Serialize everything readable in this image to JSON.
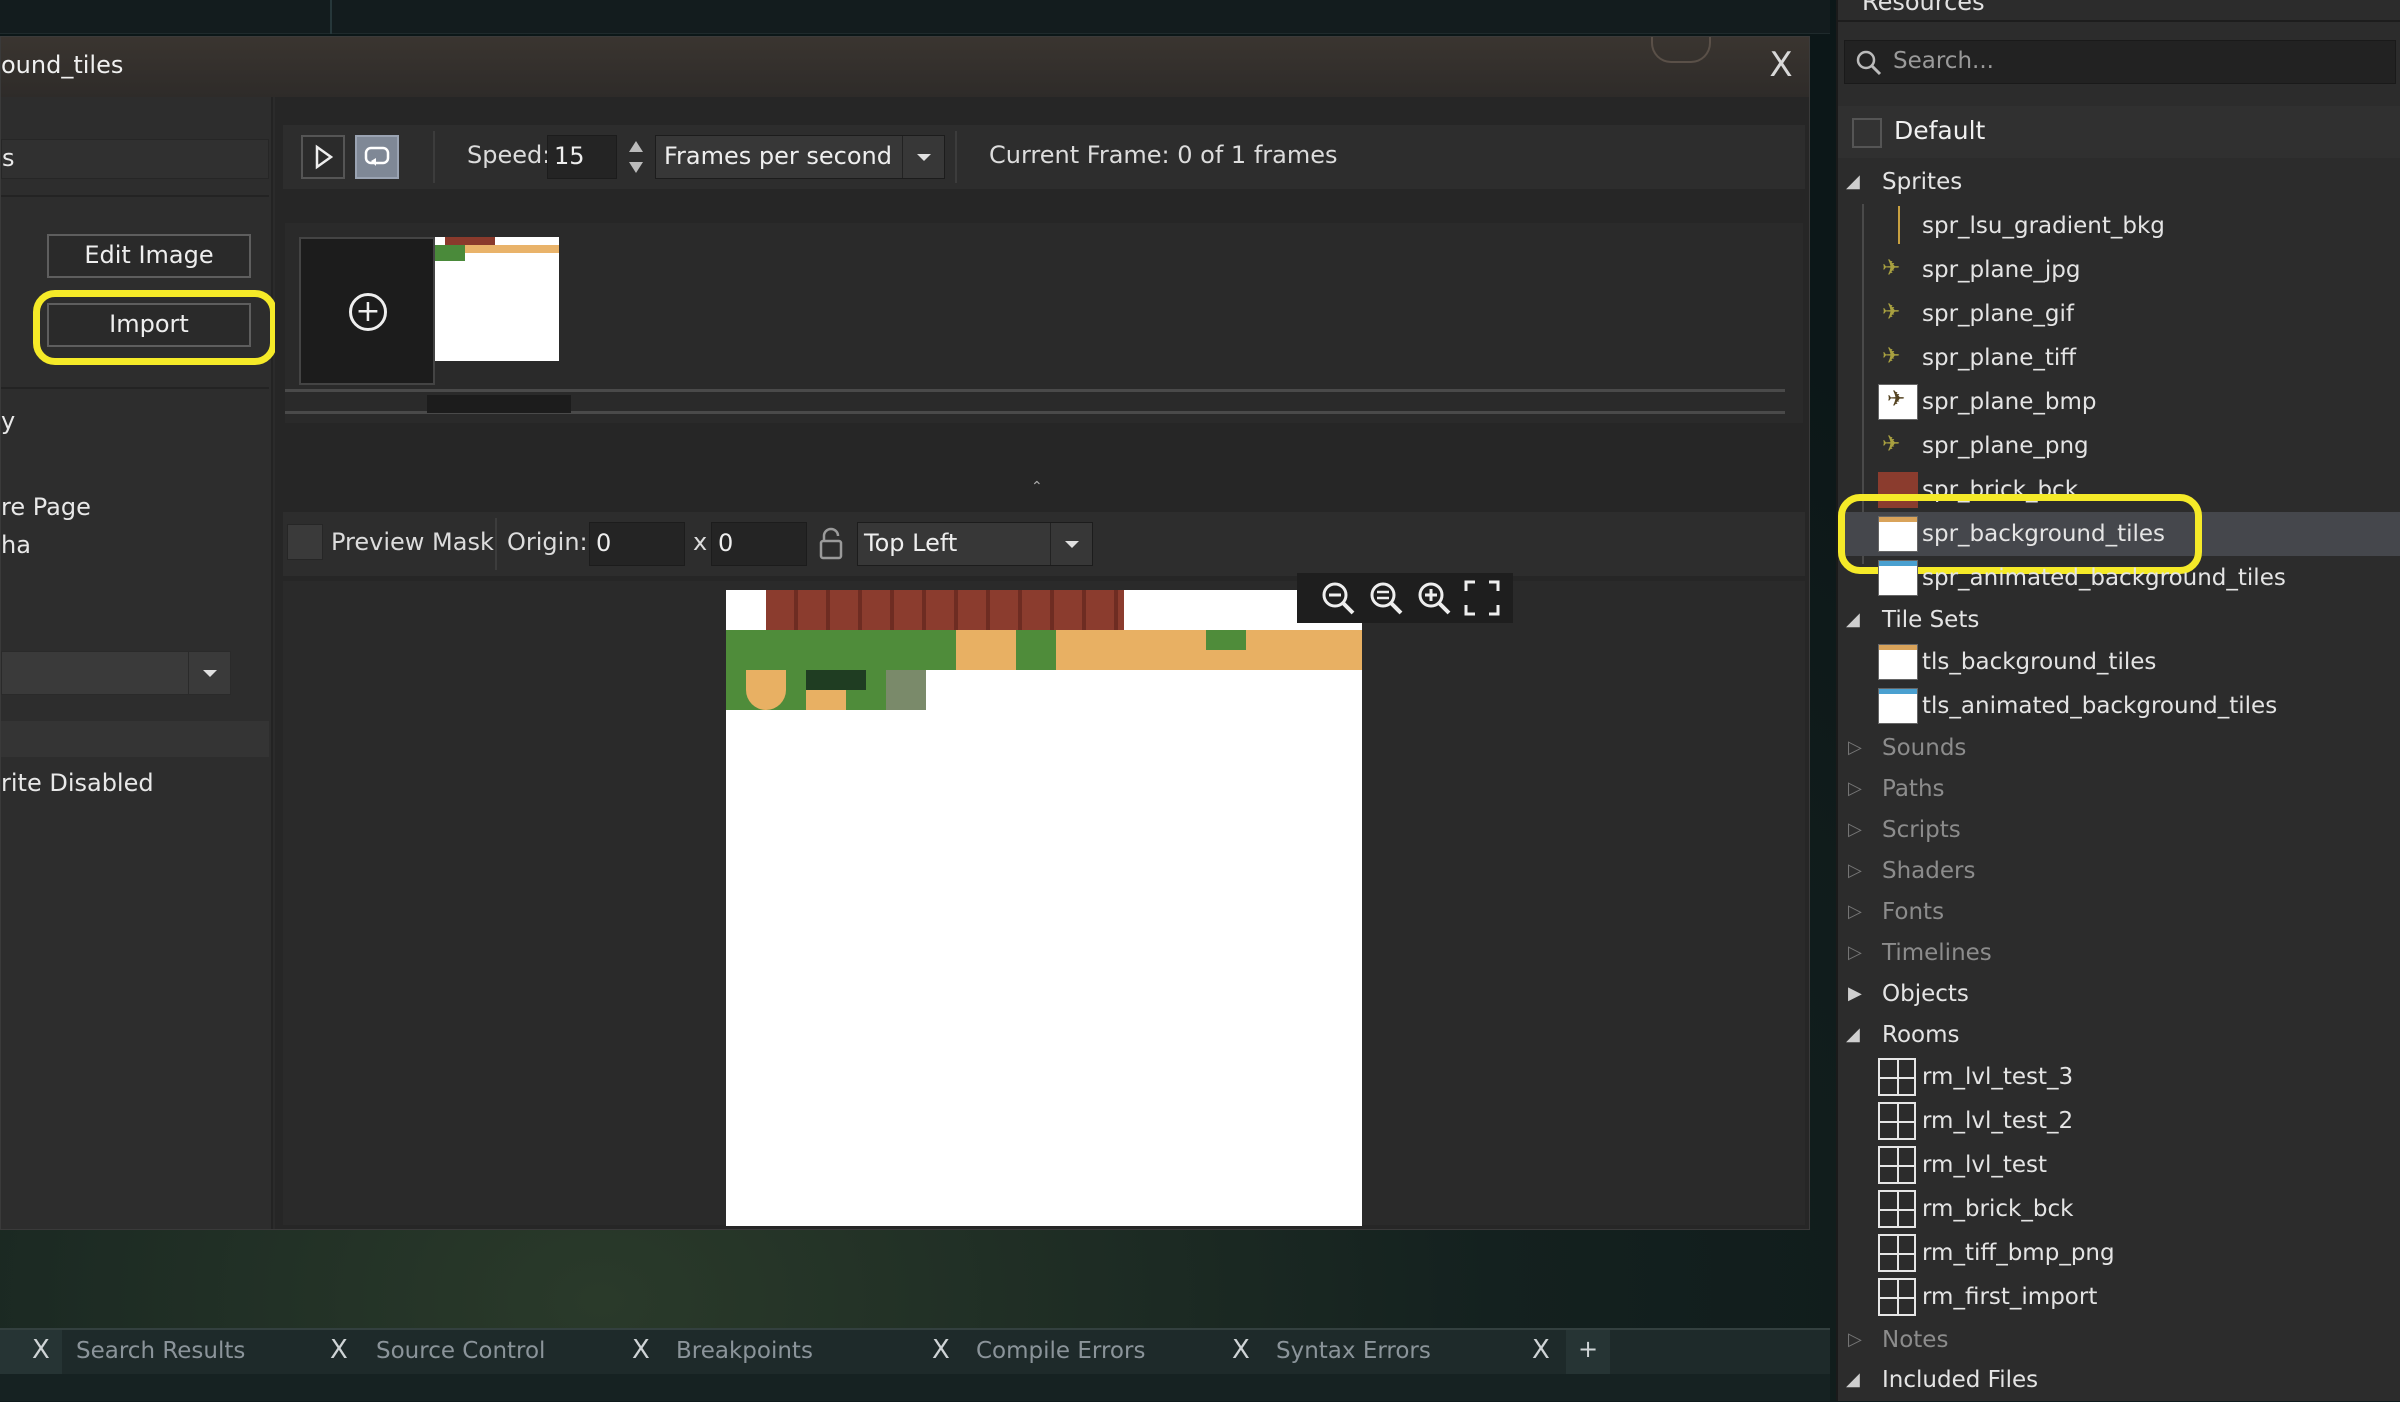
{
  "editor": {
    "title_partial": "ound_tiles",
    "close_glyph": "X",
    "left_panel": {
      "row1_partial": "s",
      "edit_image_label": "Edit Image",
      "import_label": "Import",
      "text_y": "y",
      "text_page": "re Page",
      "text_alpha": "ha",
      "text_disabled": "rite Disabled"
    },
    "toolbar": {
      "speed_label": "Speed:",
      "speed_value": "15",
      "speed_unit": "Frames per second",
      "current_frame": "Current Frame: 0 of 1 frames"
    },
    "preview_bar": {
      "preview_mask_label": "Preview Mask",
      "origin_label": "Origin:",
      "origin_x": "0",
      "origin_sep": "x",
      "origin_y": "0",
      "origin_preset": "Top Left"
    }
  },
  "resources": {
    "title": "Resources",
    "search_placeholder": "Search...",
    "default_group": "Default",
    "sprites_label": "Sprites",
    "sprites": [
      "spr_lsu_gradient_bkg",
      "spr_plane_jpg",
      "spr_plane_gif",
      "spr_plane_tiff",
      "spr_plane_bmp",
      "spr_plane_png",
      "spr_brick_bck",
      "spr_background_tiles",
      "spr_animated_background_tiles"
    ],
    "tilesets_label": "Tile Sets",
    "tilesets": [
      "tls_background_tiles",
      "tls_animated_background_tiles"
    ],
    "groups_collapsed": [
      "Sounds",
      "Paths",
      "Scripts",
      "Shaders",
      "Fonts",
      "Timelines"
    ],
    "objects_label": "Objects",
    "rooms_label": "Rooms",
    "rooms": [
      "rm_lvl_test_3",
      "rm_lvl_test_2",
      "rm_lvl_test",
      "rm_brick_bck",
      "rm_tiff_bmp_png",
      "rm_first_import"
    ],
    "notes_label": "Notes",
    "included_files_label": "Included Files"
  },
  "bottom_tabs": {
    "close_glyph": "X",
    "add_glyph": "+",
    "tabs": [
      "Search Results",
      "Source Control",
      "Breakpoints",
      "Compile Errors",
      "Syntax Errors"
    ]
  },
  "colors": {
    "highlight": "#f5ea28",
    "selected_row": "#45474c",
    "panel_bg": "#2c2c2c"
  }
}
